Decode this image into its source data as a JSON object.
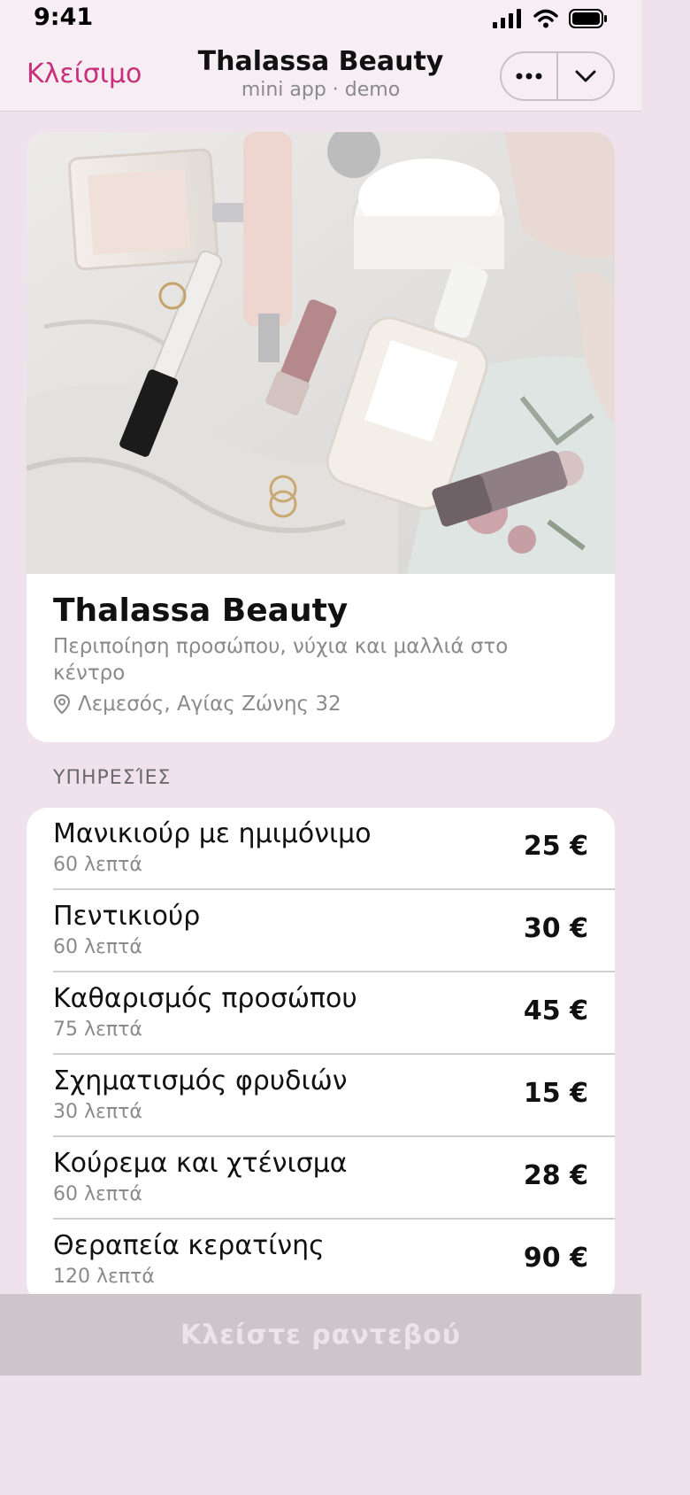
{
  "status_bar": {
    "time": "9:41",
    "icons": [
      "cellular-signal-icon",
      "wifi-icon",
      "battery-icon"
    ]
  },
  "header": {
    "close_label": "Κλείσιμο",
    "title": "Thalassa Beauty",
    "subtitle": "mini app · demo",
    "more_icon": "more-dots-icon",
    "collapse_icon": "chevron-down-icon"
  },
  "shop": {
    "name": "Thalassa Beauty",
    "description": "Περιποίηση προσώπου, νύχια και μαλλιά στο κέντρο",
    "address": "Λεμεσός, Αγίας Ζώνης 32",
    "address_icon": "location-pin-icon"
  },
  "services_label": "ΥΠΗΡΕΣΊΕΣ",
  "services": [
    {
      "name": "Μανικιούρ με ημιμόνιμο",
      "duration": "60 λεπτά",
      "price": "25 €"
    },
    {
      "name": "Πεντικιούρ",
      "duration": "60 λεπτά",
      "price": "30 €"
    },
    {
      "name": "Καθαρισμός προσώπου",
      "duration": "75 λεπτά",
      "price": "45 €"
    },
    {
      "name": "Σχηματισμός φρυδιών",
      "duration": "30 λεπτά",
      "price": "15 €"
    },
    {
      "name": "Κούρεμα και χτένισμα",
      "duration": "60 λεπτά",
      "price": "28 €"
    },
    {
      "name": "Θεραπεία κερατίνης",
      "duration": "120 λεπτά",
      "price": "90 €"
    }
  ],
  "book_button_label": "Κλείστε ραντεβού",
  "colors": {
    "accent": "#c8307c",
    "background": "#efe2ec",
    "button_disabled": "#cdc5ca"
  }
}
